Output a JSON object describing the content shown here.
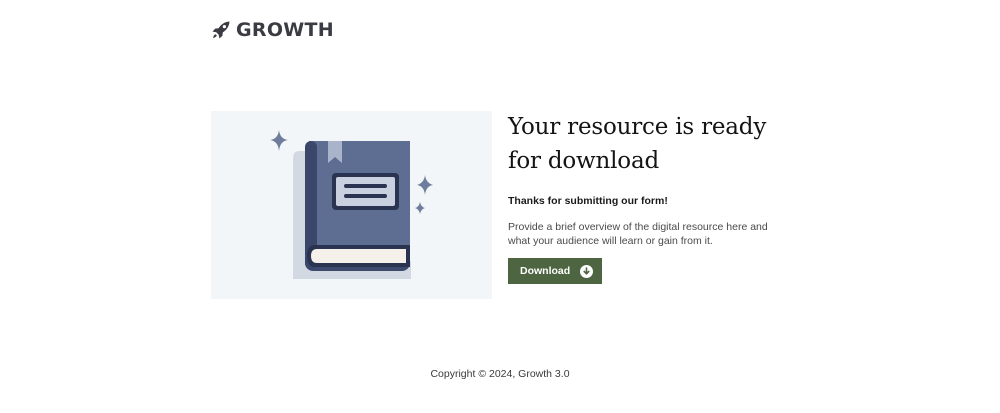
{
  "header": {
    "logo_text": "GROWTH",
    "logo_icon": "rocket-icon"
  },
  "hero": {
    "illustration": "book-icon",
    "colors": {
      "panel_bg": "#f3f6f9",
      "book_cover": "#5e6e93",
      "book_spine": "#3d4a6e",
      "book_outline": "#2a3350",
      "book_shadow": "#d3d9e3",
      "sparkle": "#6e7d9c"
    }
  },
  "main": {
    "title": "Your resource is ready for download",
    "subtitle": "Thanks for submitting our form!",
    "description": "Provide a brief overview of the digital resource here and what your audience will learn or gain from it.",
    "download_button": {
      "label": "Download",
      "icon": "download-arrow-icon",
      "color": "#4d6540"
    }
  },
  "footer": {
    "copyright": "Copyright © 2024, Growth 3.0"
  }
}
